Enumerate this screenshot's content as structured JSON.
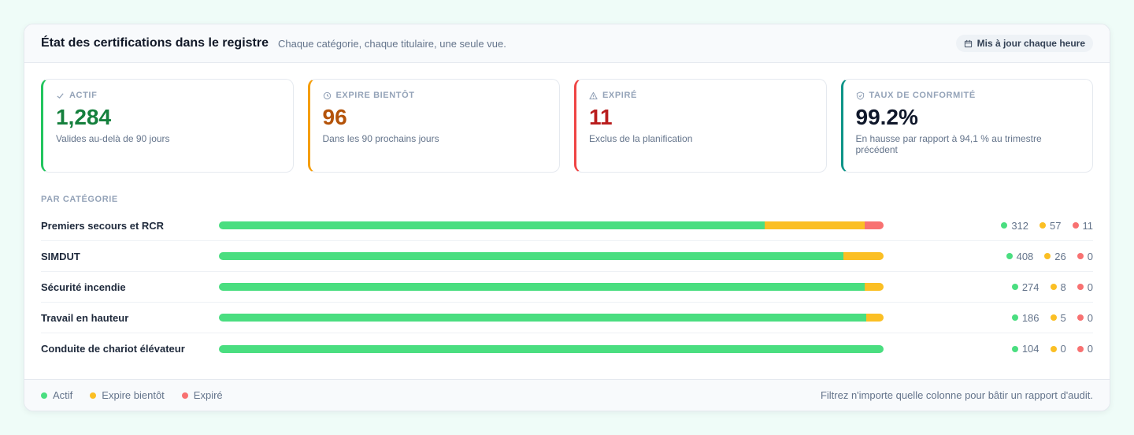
{
  "header": {
    "title": "État des certifications dans le registre",
    "subtitle": "Chaque catégorie, chaque titulaire, une seule vue.",
    "badge": "Mis à jour chaque heure"
  },
  "stats": [
    {
      "label": "ACTIF",
      "value": "1,284",
      "desc": "Valides au-delà de 90 jours",
      "icon": "check-icon",
      "color": "#15803d"
    },
    {
      "label": "EXPIRE BIENTÔT",
      "value": "96",
      "desc": "Dans les 90 prochains jours",
      "icon": "clock-icon",
      "color": "#b45309"
    },
    {
      "label": "EXPIRÉ",
      "value": "11",
      "desc": "Exclus de la planification",
      "icon": "warning-icon",
      "color": "#b91c1c"
    },
    {
      "label": "TAUX DE CONFORMITÉ",
      "value": "99.2%",
      "desc": "En hausse par rapport à 94,1 % au trimestre précédent",
      "icon": "shield-icon",
      "color": "#0f172a"
    }
  ],
  "section_label": "PAR CATÉGORIE",
  "categories": [
    {
      "name": "Premiers secours et RCR",
      "active": 312,
      "soon": 57,
      "expired": 11
    },
    {
      "name": "SIMDUT",
      "active": 408,
      "soon": 26,
      "expired": 0
    },
    {
      "name": "Sécurité incendie",
      "active": 274,
      "soon": 8,
      "expired": 0
    },
    {
      "name": "Travail en hauteur",
      "active": 186,
      "soon": 5,
      "expired": 0
    },
    {
      "name": "Conduite de chariot élévateur",
      "active": 104,
      "soon": 0,
      "expired": 0
    }
  ],
  "legend": {
    "active": "Actif",
    "soon": "Expire bientôt",
    "expired": "Expiré"
  },
  "footer_note": "Filtrez n'importe quelle colonne pour bâtir un rapport d'audit.",
  "colors": {
    "active": "#4ade80",
    "soon": "#fbbf24",
    "expired": "#f87171"
  }
}
